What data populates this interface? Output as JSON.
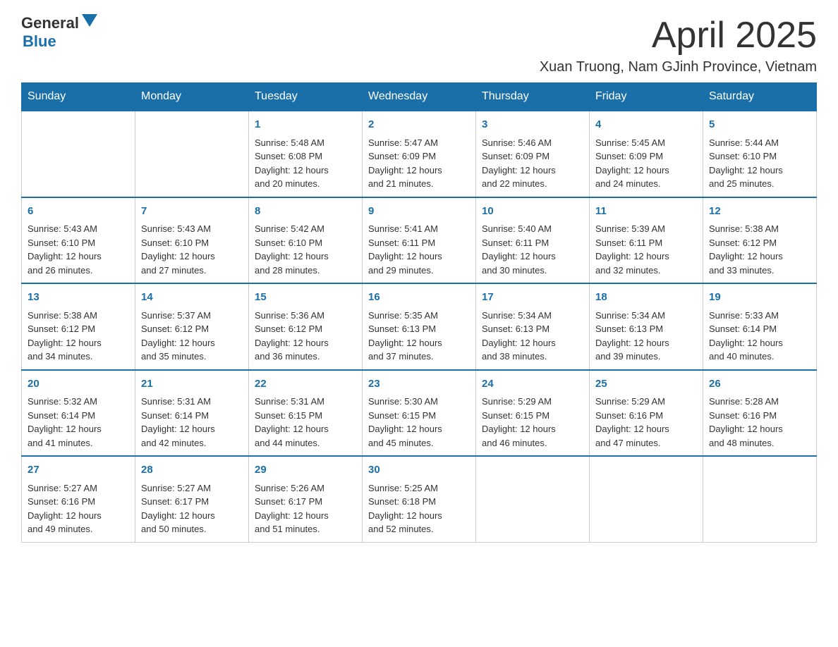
{
  "logo": {
    "text_general": "General",
    "text_blue": "Blue"
  },
  "header": {
    "month_title": "April 2025",
    "location": "Xuan Truong, Nam GJinh Province, Vietnam"
  },
  "weekdays": [
    "Sunday",
    "Monday",
    "Tuesday",
    "Wednesday",
    "Thursday",
    "Friday",
    "Saturday"
  ],
  "weeks": [
    [
      {
        "day": "",
        "info": ""
      },
      {
        "day": "",
        "info": ""
      },
      {
        "day": "1",
        "info": "Sunrise: 5:48 AM\nSunset: 6:08 PM\nDaylight: 12 hours\nand 20 minutes."
      },
      {
        "day": "2",
        "info": "Sunrise: 5:47 AM\nSunset: 6:09 PM\nDaylight: 12 hours\nand 21 minutes."
      },
      {
        "day": "3",
        "info": "Sunrise: 5:46 AM\nSunset: 6:09 PM\nDaylight: 12 hours\nand 22 minutes."
      },
      {
        "day": "4",
        "info": "Sunrise: 5:45 AM\nSunset: 6:09 PM\nDaylight: 12 hours\nand 24 minutes."
      },
      {
        "day": "5",
        "info": "Sunrise: 5:44 AM\nSunset: 6:10 PM\nDaylight: 12 hours\nand 25 minutes."
      }
    ],
    [
      {
        "day": "6",
        "info": "Sunrise: 5:43 AM\nSunset: 6:10 PM\nDaylight: 12 hours\nand 26 minutes."
      },
      {
        "day": "7",
        "info": "Sunrise: 5:43 AM\nSunset: 6:10 PM\nDaylight: 12 hours\nand 27 minutes."
      },
      {
        "day": "8",
        "info": "Sunrise: 5:42 AM\nSunset: 6:10 PM\nDaylight: 12 hours\nand 28 minutes."
      },
      {
        "day": "9",
        "info": "Sunrise: 5:41 AM\nSunset: 6:11 PM\nDaylight: 12 hours\nand 29 minutes."
      },
      {
        "day": "10",
        "info": "Sunrise: 5:40 AM\nSunset: 6:11 PM\nDaylight: 12 hours\nand 30 minutes."
      },
      {
        "day": "11",
        "info": "Sunrise: 5:39 AM\nSunset: 6:11 PM\nDaylight: 12 hours\nand 32 minutes."
      },
      {
        "day": "12",
        "info": "Sunrise: 5:38 AM\nSunset: 6:12 PM\nDaylight: 12 hours\nand 33 minutes."
      }
    ],
    [
      {
        "day": "13",
        "info": "Sunrise: 5:38 AM\nSunset: 6:12 PM\nDaylight: 12 hours\nand 34 minutes."
      },
      {
        "day": "14",
        "info": "Sunrise: 5:37 AM\nSunset: 6:12 PM\nDaylight: 12 hours\nand 35 minutes."
      },
      {
        "day": "15",
        "info": "Sunrise: 5:36 AM\nSunset: 6:12 PM\nDaylight: 12 hours\nand 36 minutes."
      },
      {
        "day": "16",
        "info": "Sunrise: 5:35 AM\nSunset: 6:13 PM\nDaylight: 12 hours\nand 37 minutes."
      },
      {
        "day": "17",
        "info": "Sunrise: 5:34 AM\nSunset: 6:13 PM\nDaylight: 12 hours\nand 38 minutes."
      },
      {
        "day": "18",
        "info": "Sunrise: 5:34 AM\nSunset: 6:13 PM\nDaylight: 12 hours\nand 39 minutes."
      },
      {
        "day": "19",
        "info": "Sunrise: 5:33 AM\nSunset: 6:14 PM\nDaylight: 12 hours\nand 40 minutes."
      }
    ],
    [
      {
        "day": "20",
        "info": "Sunrise: 5:32 AM\nSunset: 6:14 PM\nDaylight: 12 hours\nand 41 minutes."
      },
      {
        "day": "21",
        "info": "Sunrise: 5:31 AM\nSunset: 6:14 PM\nDaylight: 12 hours\nand 42 minutes."
      },
      {
        "day": "22",
        "info": "Sunrise: 5:31 AM\nSunset: 6:15 PM\nDaylight: 12 hours\nand 44 minutes."
      },
      {
        "day": "23",
        "info": "Sunrise: 5:30 AM\nSunset: 6:15 PM\nDaylight: 12 hours\nand 45 minutes."
      },
      {
        "day": "24",
        "info": "Sunrise: 5:29 AM\nSunset: 6:15 PM\nDaylight: 12 hours\nand 46 minutes."
      },
      {
        "day": "25",
        "info": "Sunrise: 5:29 AM\nSunset: 6:16 PM\nDaylight: 12 hours\nand 47 minutes."
      },
      {
        "day": "26",
        "info": "Sunrise: 5:28 AM\nSunset: 6:16 PM\nDaylight: 12 hours\nand 48 minutes."
      }
    ],
    [
      {
        "day": "27",
        "info": "Sunrise: 5:27 AM\nSunset: 6:16 PM\nDaylight: 12 hours\nand 49 minutes."
      },
      {
        "day": "28",
        "info": "Sunrise: 5:27 AM\nSunset: 6:17 PM\nDaylight: 12 hours\nand 50 minutes."
      },
      {
        "day": "29",
        "info": "Sunrise: 5:26 AM\nSunset: 6:17 PM\nDaylight: 12 hours\nand 51 minutes."
      },
      {
        "day": "30",
        "info": "Sunrise: 5:25 AM\nSunset: 6:18 PM\nDaylight: 12 hours\nand 52 minutes."
      },
      {
        "day": "",
        "info": ""
      },
      {
        "day": "",
        "info": ""
      },
      {
        "day": "",
        "info": ""
      }
    ]
  ]
}
